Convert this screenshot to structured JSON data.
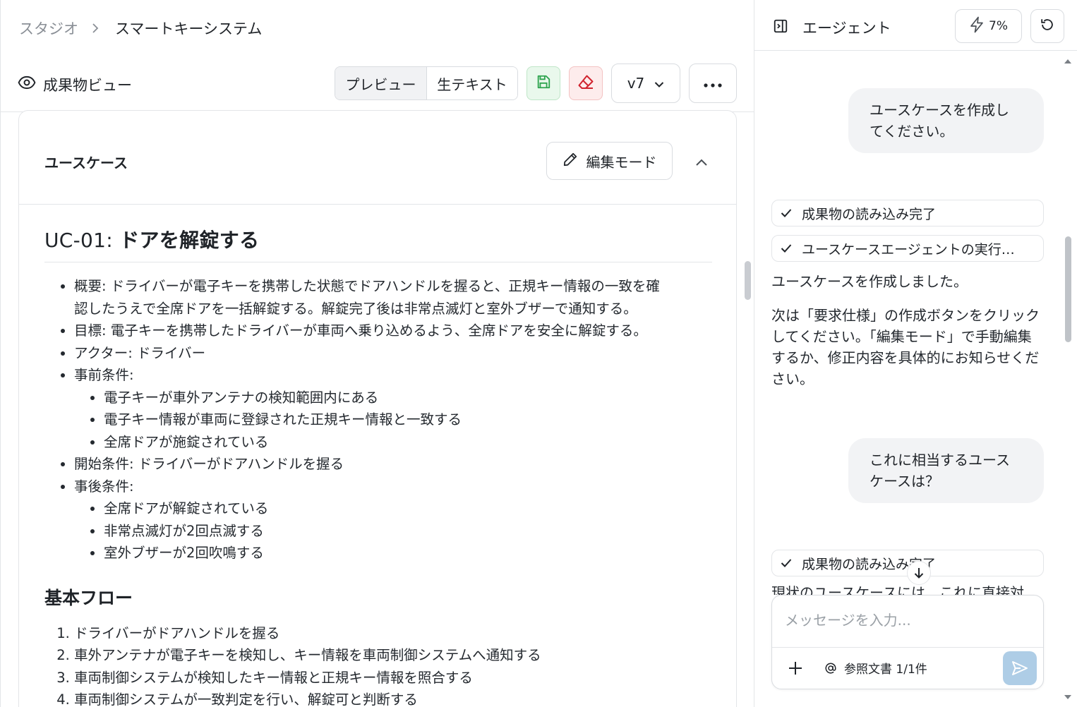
{
  "breadcrumb": {
    "root": "スタジオ",
    "current": "スマートキーシステム"
  },
  "view": {
    "title": "成果物ビュー",
    "tabs": {
      "preview": "プレビュー",
      "raw": "生テキスト"
    },
    "version": "v7"
  },
  "card": {
    "title": "ユースケース",
    "edit_label": "編集モード",
    "doc": {
      "h1_id": "UC-01:",
      "h1_title": "ドアを解錠する",
      "overview_1": "概要: ドライバーが電子キーを携帯した状態でドアハンドルを握ると、正規キー情報の一致を確",
      "overview_2": "認したうえで全席ドアを一括解錠する。解錠完了後は非常点滅灯と室外ブザーで通知する。",
      "goal": "目標: 電子キーを携帯したドライバーが車両へ乗り込めるよう、全席ドアを安全に解錠する。",
      "actor": "アクター: ドライバー",
      "pre_label": "事前条件:",
      "pre": [
        "電子キーが車外アンテナの検知範囲内にある",
        "電子キー情報が車両に登録された正規キー情報と一致する",
        "全席ドアが施錠されている"
      ],
      "trigger": "開始条件: ドライバーがドアハンドルを握る",
      "post_label": "事後条件:",
      "post": [
        "全席ドアが解錠されている",
        "非常点滅灯が2回点滅する",
        "室外ブザーが2回吹鳴する"
      ],
      "flow_title": "基本フロー",
      "flow": [
        "ドライバーがドアハンドルを握る",
        "車外アンテナが電子キーを検知し、キー情報を車両制御システムへ通知する",
        "車両制御システムが検知したキー情報と正規キー情報を照合する",
        "車両制御システムが一致判定を行い、解錠可と判断する"
      ]
    }
  },
  "agent": {
    "title": "エージェント",
    "usage": "7%",
    "messages": {
      "user1": "ユースケースを作成してください。",
      "status1": "成果物の読み込み完了",
      "status2": "ユースケースエージェントの実行完了",
      "reply1": "ユースケースを作成しました。",
      "reply2": "次は「要求仕様」の作成ボタンをクリックしてください。「編集モード」で手動編集するか、修正内容を具体的にお知らせください。",
      "user2": "これに相当するユースケースは？",
      "status3": "成果物の読み込み完了",
      "reply3_partial": "現状のユースケースには、これに直接対"
    },
    "composer": {
      "placeholder": "メッセージを入力...",
      "ref_label": "参照文書 1/1件"
    }
  },
  "colors": {
    "save": "#2ea44f",
    "erase": "#d1242f",
    "send": "#aecde6"
  }
}
